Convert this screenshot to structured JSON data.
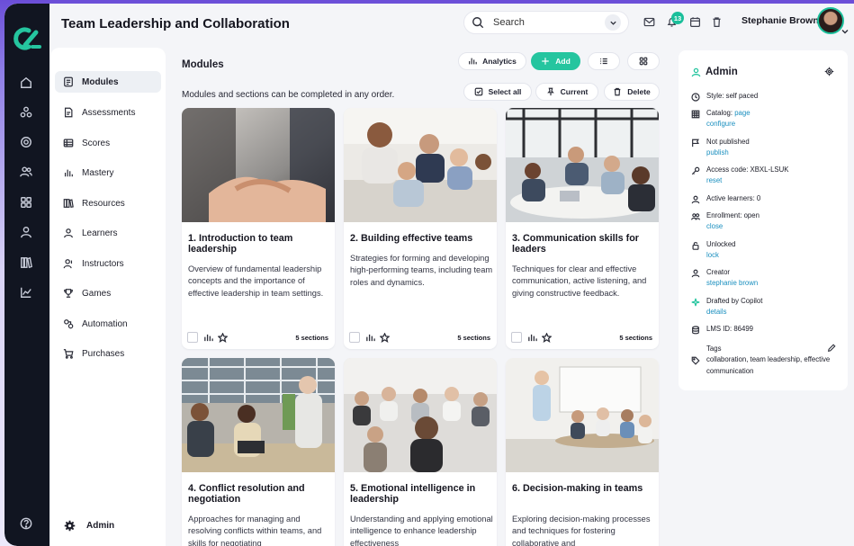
{
  "header": {
    "title": "Team Leadership and Collaboration",
    "search_placeholder": "Search",
    "notification_count": "13",
    "user_name": "Stephanie Brown"
  },
  "subnav": {
    "items": [
      {
        "label": "Modules",
        "icon": "module-icon",
        "active": true
      },
      {
        "label": "Assessments",
        "icon": "assessment-icon"
      },
      {
        "label": "Scores",
        "icon": "table-icon"
      },
      {
        "label": "Mastery",
        "icon": "bar-chart-icon"
      },
      {
        "label": "Resources",
        "icon": "books-icon"
      },
      {
        "label": "Learners",
        "icon": "user-icon"
      },
      {
        "label": "Instructors",
        "icon": "instructor-icon"
      },
      {
        "label": "Games",
        "icon": "trophy-icon"
      },
      {
        "label": "Automation",
        "icon": "automation-icon"
      },
      {
        "label": "Purchases",
        "icon": "cart-icon"
      }
    ],
    "footer_label": "Admin"
  },
  "main": {
    "title": "Modules",
    "description": "Modules and sections can be completed in any order.",
    "toolbar": {
      "analytics": "Analytics",
      "add": "Add",
      "select_all": "Select all",
      "current": "Current",
      "delete": "Delete"
    },
    "cards": [
      {
        "title": "1. Introduction to team leadership",
        "description": "Overview of fundamental leadership concepts and the importance of effective leadership in team settings.",
        "sections": "5 sections"
      },
      {
        "title": "2. Building effective teams",
        "description": "Strategies for forming and developing high-performing teams, including team roles and dynamics.",
        "sections": "5 sections"
      },
      {
        "title": "3. Communication skills for leaders",
        "description": "Techniques for clear and effective communication, active listening, and giving constructive feedback.",
        "sections": "5 sections"
      },
      {
        "title": "4. Conflict resolution and negotiation",
        "description": "Approaches for managing and resolving conflicts within teams, and skills for negotiating"
      },
      {
        "title": "5. Emotional intelligence in leadership",
        "description": "Understanding and applying emotional intelligence to enhance leadership effectiveness"
      },
      {
        "title": "6. Decision-making in teams",
        "description": "Exploring decision-making processes and techniques for fostering collaborative and"
      }
    ]
  },
  "admin_panel": {
    "title": "Admin",
    "style": "Style: self paced",
    "catalog_label": "Catalog: ",
    "catalog_link": "page",
    "catalog_action": "configure",
    "publish_status": "Not published",
    "publish_action": "publish",
    "access_code": "Access code: XBXL-LSUK",
    "access_action": "reset",
    "active_learners": "Active learners: 0",
    "enrollment": "Enrollment: open",
    "enrollment_action": "close",
    "lock_status": "Unlocked",
    "lock_action": "lock",
    "creator_label": "Creator",
    "creator_name": "stephanie brown",
    "drafted": "Drafted by Copilot",
    "drafted_action": "details",
    "lms_id": "LMS ID: 86499",
    "tags_label": "Tags",
    "tags": "collaboration, team leadership, effective communication"
  },
  "colors": {
    "accent": "#25c59f",
    "link": "#1a8fbf",
    "rail": "#111521"
  }
}
